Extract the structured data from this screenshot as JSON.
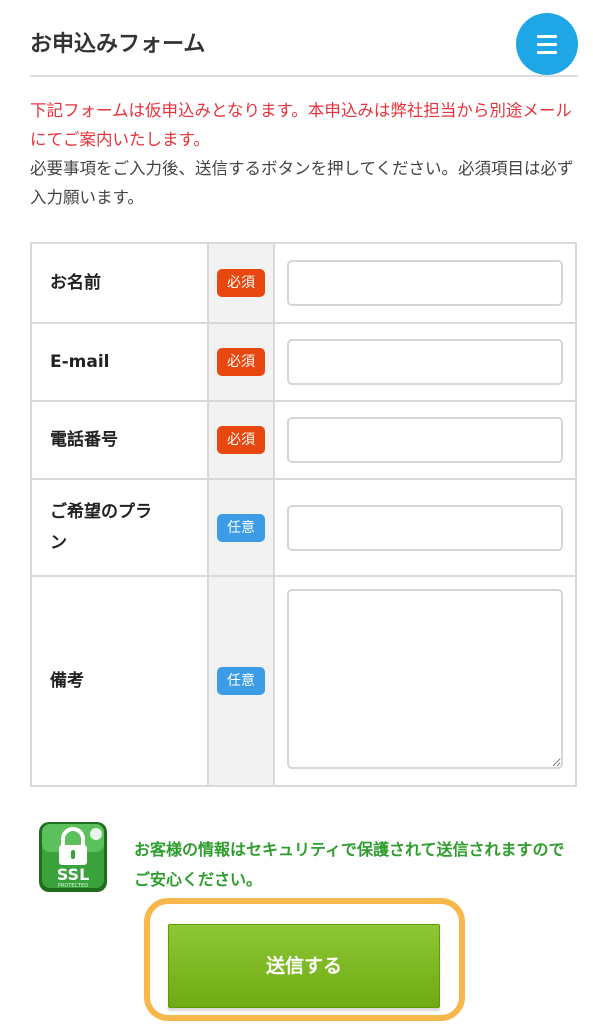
{
  "page": {
    "title": "お申込みフォーム",
    "menu_icon": "hamburger-menu-icon"
  },
  "notice": {
    "red_text": "下記フォームは仮申込みとなります。本申込みは弊社担当から別途メールにてご案内いたします。",
    "body_text": "必要事項をご入力後、送信するボタンを押してください。必須項目は必ず入力願います。"
  },
  "form": {
    "rows": [
      {
        "label": "お名前",
        "badge": "必須",
        "required": true,
        "type": "text",
        "value": ""
      },
      {
        "label": "E-mail",
        "badge": "必須",
        "required": true,
        "type": "text",
        "value": ""
      },
      {
        "label": "電話番号",
        "badge": "必須",
        "required": true,
        "type": "text",
        "value": ""
      },
      {
        "label": "ご希望のプラン",
        "badge": "任意",
        "required": false,
        "type": "text",
        "value": ""
      },
      {
        "label": "備考",
        "badge": "任意",
        "required": false,
        "type": "textarea",
        "value": ""
      }
    ]
  },
  "security": {
    "icon": "ssl-lock-icon",
    "icon_text": "SSL",
    "icon_subtext": "PROTECTED",
    "text": "お客様の情報はセキュリティで保護されて送信されますのでご安心ください。"
  },
  "submit": {
    "label": "送信する"
  },
  "colors": {
    "accent_blue": "#1ea6e6",
    "required_badge": "#e8470f",
    "optional_badge": "#3c9de6",
    "notice_red": "#e8323c",
    "security_green": "#2f9c2e",
    "submit_green": "#7ab824",
    "submit_outline": "#f8b74a"
  }
}
